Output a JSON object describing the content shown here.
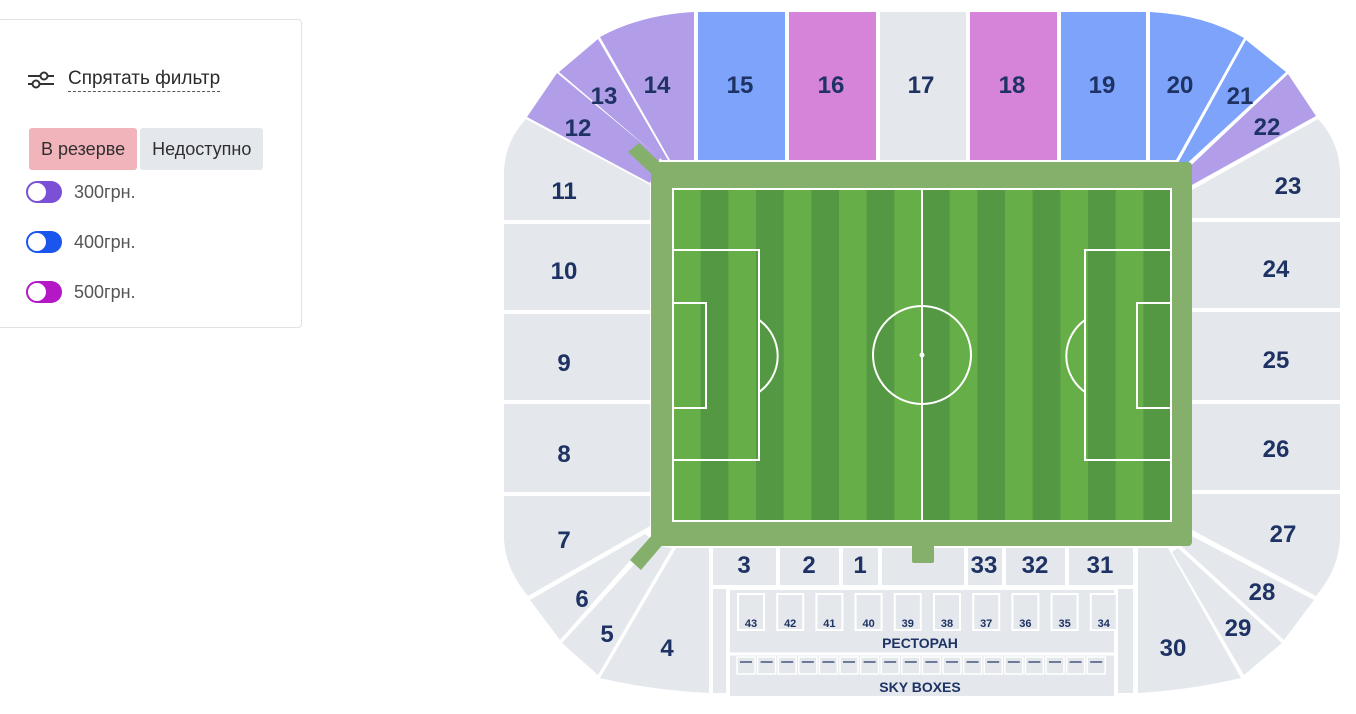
{
  "filter": {
    "toggle_label": "Спрятать фильтр",
    "statuses": [
      {
        "label": "В резерве",
        "color": "#f2b4bb"
      },
      {
        "label": "Недоступно",
        "color": "#e4e8ec"
      }
    ],
    "legend": [
      {
        "label": "300грн.",
        "color": "#7b4fd6"
      },
      {
        "label": "400грн.",
        "color": "#1a55ee"
      },
      {
        "label": "500грн.",
        "color": "#b417c6"
      }
    ]
  },
  "colors": {
    "price_300": "#b19de8",
    "price_400": "#7da3fb",
    "price_500": "#d683da",
    "unavailable": "#e4e8ec",
    "grass_dark": "#559843",
    "grass_light": "#65ae48",
    "pitch_border": "#84b06c",
    "label": "#1e3264"
  },
  "stadium": {
    "sections": {
      "s1": "1",
      "s2": "2",
      "s3": "3",
      "s4": "4",
      "s5": "5",
      "s6": "6",
      "s7": "7",
      "s8": "8",
      "s9": "9",
      "s10": "10",
      "s11": "11",
      "s12": "12",
      "s13": "13",
      "s14": "14",
      "s15": "15",
      "s16": "16",
      "s17": "17",
      "s18": "18",
      "s19": "19",
      "s20": "20",
      "s21": "21",
      "s22": "22",
      "s23": "23",
      "s24": "24",
      "s25": "25",
      "s26": "26",
      "s27": "27",
      "s28": "28",
      "s29": "29",
      "s30": "30",
      "s31": "31",
      "s32": "32",
      "s33": "33"
    },
    "restaurant_label": "РЕСТОРАН",
    "restaurant_boxes": [
      "43",
      "42",
      "41",
      "40",
      "39",
      "38",
      "37",
      "36",
      "35",
      "34"
    ],
    "skybox_label": "SKY BOXES"
  }
}
